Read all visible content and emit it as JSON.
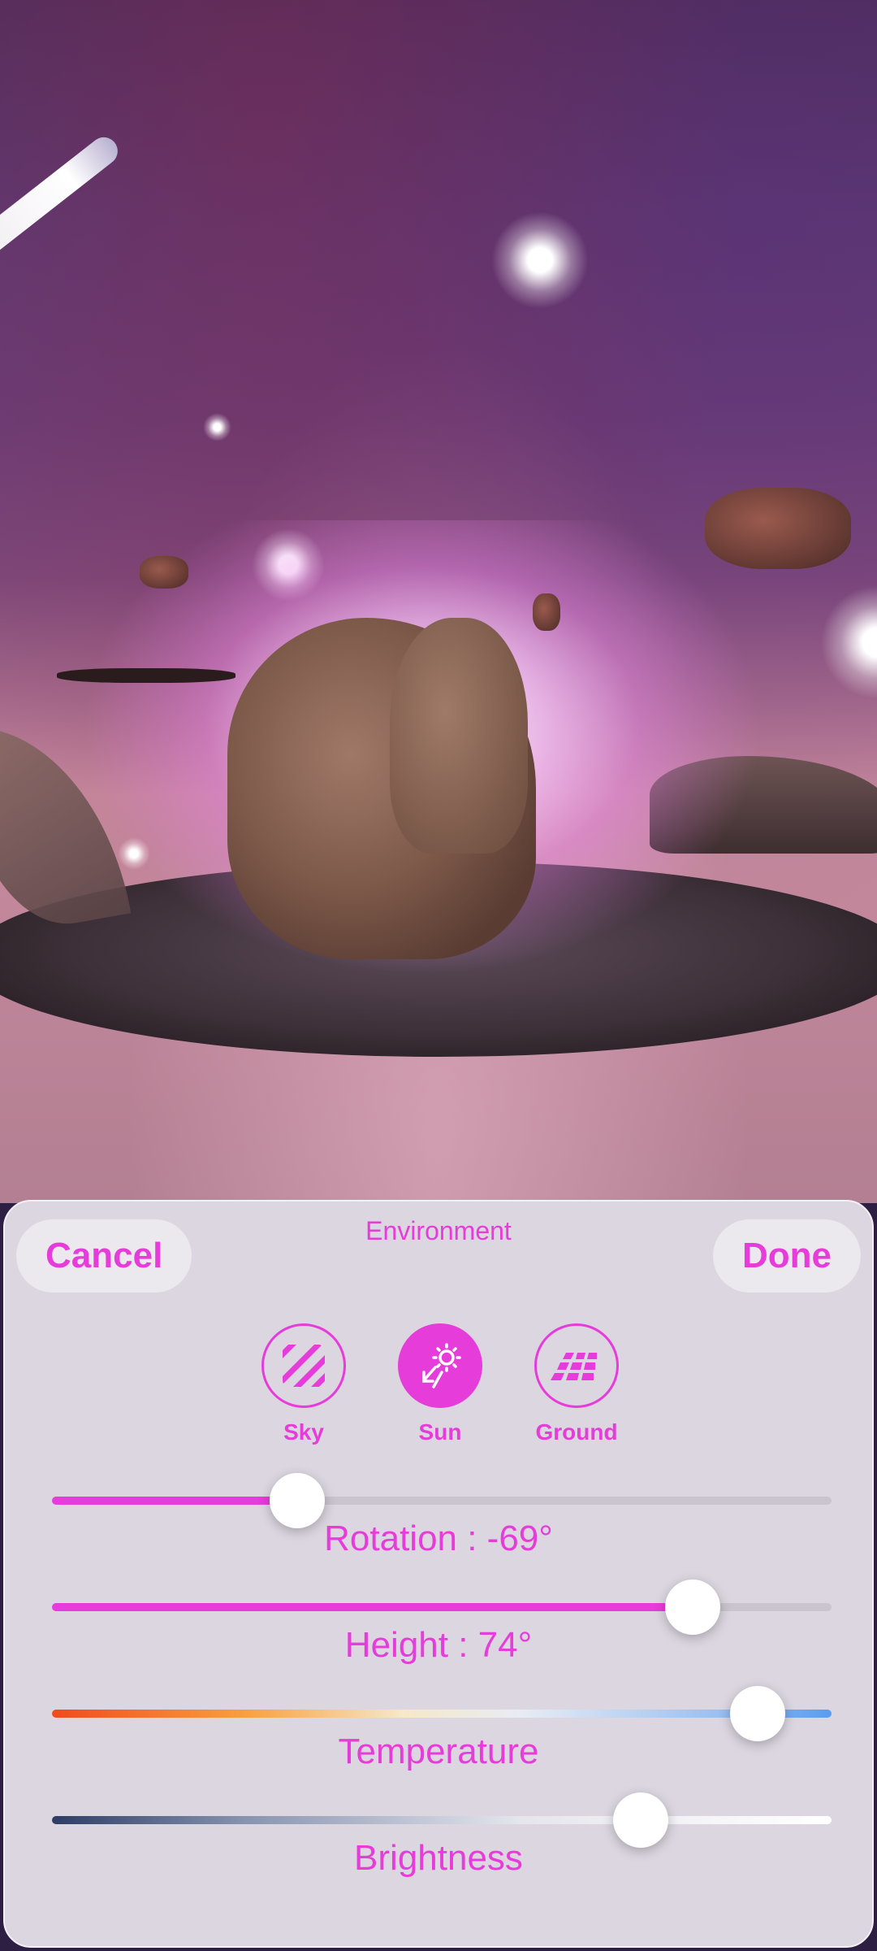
{
  "sheet": {
    "title": "Environment",
    "cancel_label": "Cancel",
    "done_label": "Done"
  },
  "modes": [
    {
      "label": "Sky",
      "icon": "sky-stripes-icon",
      "active": false
    },
    {
      "label": "Sun",
      "icon": "sun-direction-icon",
      "active": true
    },
    {
      "label": "Ground",
      "icon": "ground-grid-icon",
      "active": false
    }
  ],
  "sliders": {
    "rotation": {
      "label": "Rotation : -69°",
      "fraction": 0.315
    },
    "height": {
      "label": "Height : 74°",
      "fraction": 0.822
    },
    "temperature": {
      "label": "Temperature",
      "fraction": 0.905
    },
    "brightness": {
      "label": "Brightness",
      "fraction": 0.755
    }
  },
  "colors": {
    "accent": "#e63cd9",
    "sheet": "#dcd6e0"
  }
}
